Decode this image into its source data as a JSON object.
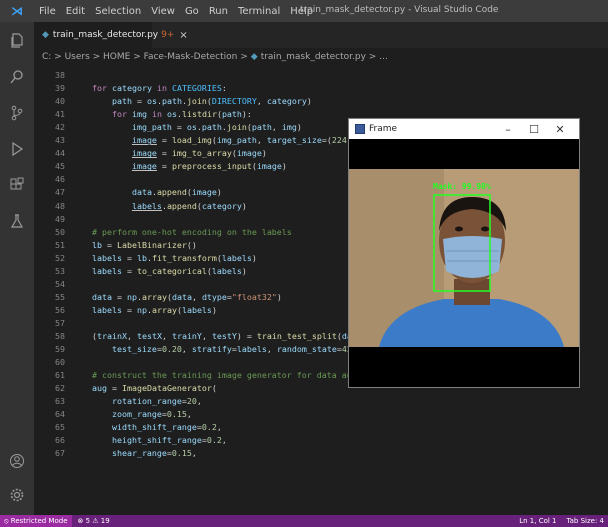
{
  "titlebar": {
    "menu": [
      "File",
      "Edit",
      "Selection",
      "View",
      "Go",
      "Run",
      "Terminal",
      "Help"
    ],
    "window_title": "train_mask_detector.py - Visual Studio Code"
  },
  "tab": {
    "label": "train_mask_detector.py",
    "problems_badge": "9+",
    "close": "×"
  },
  "breadcrumb": {
    "path": "C: > Users > HOME > Face-Mask-Detection >",
    "file": "train_mask_detector.py >",
    "tail": "..."
  },
  "frame_window": {
    "title": "Frame",
    "minimize": "–",
    "maximize": "☐",
    "close": "✕",
    "detection_label": "Mask: 99.98%"
  },
  "code_lines": [
    {
      "n": "38",
      "t": []
    },
    {
      "n": "39",
      "t": [
        [
          "    ",
          ""
        ],
        [
          "for",
          "kw"
        ],
        [
          " ",
          ""
        ],
        [
          "category",
          "var"
        ],
        [
          " ",
          ""
        ],
        [
          "in",
          "kw"
        ],
        [
          " ",
          ""
        ],
        [
          "CATEGORIES",
          "cst"
        ],
        [
          ":",
          ""
        ]
      ]
    },
    {
      "n": "40",
      "t": [
        [
          "        ",
          ""
        ],
        [
          "path",
          "var"
        ],
        [
          " = ",
          ""
        ],
        [
          "os",
          "var"
        ],
        [
          ".",
          ""
        ],
        [
          "path",
          "var"
        ],
        [
          ".",
          ""
        ],
        [
          "join",
          "fn"
        ],
        [
          "(",
          ""
        ],
        [
          "DIRECTORY",
          "cst"
        ],
        [
          ", ",
          ""
        ],
        [
          "category",
          "var"
        ],
        [
          ")",
          ""
        ]
      ]
    },
    {
      "n": "41",
      "t": [
        [
          "        ",
          ""
        ],
        [
          "for",
          "kw"
        ],
        [
          " ",
          ""
        ],
        [
          "img",
          "var"
        ],
        [
          " ",
          ""
        ],
        [
          "in",
          "kw"
        ],
        [
          " ",
          ""
        ],
        [
          "os",
          "var"
        ],
        [
          ".",
          ""
        ],
        [
          "listdir",
          "fn"
        ],
        [
          "(",
          ""
        ],
        [
          "path",
          "var"
        ],
        [
          "):",
          ""
        ]
      ]
    },
    {
      "n": "42",
      "t": [
        [
          "            ",
          ""
        ],
        [
          "img_path",
          "var"
        ],
        [
          " = ",
          ""
        ],
        [
          "os",
          "var"
        ],
        [
          ".",
          ""
        ],
        [
          "path",
          "var"
        ],
        [
          ".",
          ""
        ],
        [
          "join",
          "fn"
        ],
        [
          "(",
          ""
        ],
        [
          "path",
          "var"
        ],
        [
          ", ",
          ""
        ],
        [
          "img",
          "var"
        ],
        [
          ")",
          ""
        ]
      ]
    },
    {
      "n": "43",
      "t": [
        [
          "            ",
          ""
        ],
        [
          "image",
          "var und"
        ],
        [
          " = ",
          ""
        ],
        [
          "load_img",
          "fn"
        ],
        [
          "(",
          ""
        ],
        [
          "img_path",
          "var"
        ],
        [
          ", ",
          ""
        ],
        [
          "target_size",
          "var"
        ],
        [
          "=(",
          ""
        ],
        [
          "224",
          "num"
        ],
        [
          ", ",
          ""
        ],
        [
          "224",
          "num"
        ],
        [
          "))",
          ""
        ]
      ]
    },
    {
      "n": "44",
      "t": [
        [
          "            ",
          ""
        ],
        [
          "image",
          "var und"
        ],
        [
          " = ",
          ""
        ],
        [
          "img_to_array",
          "fn"
        ],
        [
          "(",
          ""
        ],
        [
          "image",
          "var"
        ],
        [
          ")",
          ""
        ]
      ]
    },
    {
      "n": "45",
      "t": [
        [
          "            ",
          ""
        ],
        [
          "image",
          "var und"
        ],
        [
          " = ",
          ""
        ],
        [
          "preprocess_input",
          "fn"
        ],
        [
          "(",
          ""
        ],
        [
          "image",
          "var"
        ],
        [
          ")",
          ""
        ]
      ]
    },
    {
      "n": "46",
      "t": []
    },
    {
      "n": "47",
      "t": [
        [
          "            ",
          ""
        ],
        [
          "data",
          "var"
        ],
        [
          ".",
          ""
        ],
        [
          "append",
          "fn"
        ],
        [
          "(",
          ""
        ],
        [
          "image",
          "var"
        ],
        [
          ")",
          ""
        ]
      ]
    },
    {
      "n": "48",
      "t": [
        [
          "            ",
          ""
        ],
        [
          "labels",
          "var und"
        ],
        [
          ".",
          ""
        ],
        [
          "append",
          "fn"
        ],
        [
          "(",
          ""
        ],
        [
          "category",
          "var"
        ],
        [
          ")",
          ""
        ]
      ]
    },
    {
      "n": "49",
      "t": []
    },
    {
      "n": "50",
      "t": [
        [
          "    ",
          ""
        ],
        [
          "# perform one-hot encoding on the labels",
          "cmt"
        ]
      ]
    },
    {
      "n": "51",
      "t": [
        [
          "    ",
          ""
        ],
        [
          "lb",
          "var"
        ],
        [
          " = ",
          ""
        ],
        [
          "LabelBinarizer",
          "fn"
        ],
        [
          "()",
          ""
        ]
      ]
    },
    {
      "n": "52",
      "t": [
        [
          "    ",
          ""
        ],
        [
          "labels",
          "var"
        ],
        [
          " = ",
          ""
        ],
        [
          "lb",
          "var"
        ],
        [
          ".",
          ""
        ],
        [
          "fit_transform",
          "fn"
        ],
        [
          "(",
          ""
        ],
        [
          "labels",
          "var"
        ],
        [
          ")",
          ""
        ]
      ]
    },
    {
      "n": "53",
      "t": [
        [
          "    ",
          ""
        ],
        [
          "labels",
          "var"
        ],
        [
          " = ",
          ""
        ],
        [
          "to_categorical",
          "fn"
        ],
        [
          "(",
          ""
        ],
        [
          "labels",
          "var"
        ],
        [
          ")",
          ""
        ]
      ]
    },
    {
      "n": "54",
      "t": []
    },
    {
      "n": "55",
      "t": [
        [
          "    ",
          ""
        ],
        [
          "data",
          "var"
        ],
        [
          " = ",
          ""
        ],
        [
          "np",
          "var"
        ],
        [
          ".",
          ""
        ],
        [
          "array",
          "fn"
        ],
        [
          "(",
          ""
        ],
        [
          "data",
          "var"
        ],
        [
          ", ",
          ""
        ],
        [
          "dtype",
          "var"
        ],
        [
          "=",
          ""
        ],
        [
          "\"float32\"",
          "str"
        ],
        [
          ")",
          ""
        ]
      ]
    },
    {
      "n": "56",
      "t": [
        [
          "    ",
          ""
        ],
        [
          "labels",
          "var"
        ],
        [
          " = ",
          ""
        ],
        [
          "np",
          "var"
        ],
        [
          ".",
          ""
        ],
        [
          "array",
          "fn"
        ],
        [
          "(",
          ""
        ],
        [
          "labels",
          "var"
        ],
        [
          ")",
          ""
        ]
      ]
    },
    {
      "n": "57",
      "t": []
    },
    {
      "n": "58",
      "t": [
        [
          "    ",
          ""
        ],
        [
          "(",
          ""
        ],
        [
          "trainX",
          "var"
        ],
        [
          ", ",
          ""
        ],
        [
          "testX",
          "var"
        ],
        [
          ", ",
          ""
        ],
        [
          "trainY",
          "var"
        ],
        [
          ", ",
          ""
        ],
        [
          "testY",
          "var"
        ],
        [
          ") = ",
          ""
        ],
        [
          "train_test_split",
          "fn"
        ],
        [
          "(",
          ""
        ],
        [
          "data",
          "var"
        ],
        [
          ", ",
          ""
        ],
        [
          "labels",
          "var"
        ],
        [
          ",",
          ""
        ]
      ]
    },
    {
      "n": "59",
      "t": [
        [
          "        ",
          ""
        ],
        [
          "test_size",
          "var"
        ],
        [
          "=",
          ""
        ],
        [
          "0.20",
          "num"
        ],
        [
          ", ",
          ""
        ],
        [
          "stratify",
          "var"
        ],
        [
          "=",
          ""
        ],
        [
          "labels",
          "var"
        ],
        [
          ", ",
          ""
        ],
        [
          "random_state",
          "var"
        ],
        [
          "=",
          ""
        ],
        [
          "42",
          "num"
        ],
        [
          ")",
          ""
        ]
      ]
    },
    {
      "n": "60",
      "t": []
    },
    {
      "n": "61",
      "t": [
        [
          "    ",
          ""
        ],
        [
          "# construct the training image generator for data augmentation",
          "cmt"
        ]
      ]
    },
    {
      "n": "62",
      "t": [
        [
          "    ",
          ""
        ],
        [
          "aug",
          "var"
        ],
        [
          " = ",
          ""
        ],
        [
          "ImageDataGenerator",
          "fn"
        ],
        [
          "(",
          ""
        ]
      ]
    },
    {
      "n": "63",
      "t": [
        [
          "        ",
          ""
        ],
        [
          "rotation_range",
          "var"
        ],
        [
          "=",
          ""
        ],
        [
          "20",
          "num"
        ],
        [
          ",",
          ""
        ]
      ]
    },
    {
      "n": "64",
      "t": [
        [
          "        ",
          ""
        ],
        [
          "zoom_range",
          "var"
        ],
        [
          "=",
          ""
        ],
        [
          "0.15",
          "num"
        ],
        [
          ",",
          ""
        ]
      ]
    },
    {
      "n": "65",
      "t": [
        [
          "        ",
          ""
        ],
        [
          "width_shift_range",
          "var"
        ],
        [
          "=",
          ""
        ],
        [
          "0.2",
          "num"
        ],
        [
          ",",
          ""
        ]
      ]
    },
    {
      "n": "66",
      "t": [
        [
          "        ",
          ""
        ],
        [
          "height_shift_range",
          "var"
        ],
        [
          "=",
          ""
        ],
        [
          "0.2",
          "num"
        ],
        [
          ",",
          ""
        ]
      ]
    },
    {
      "n": "67",
      "t": [
        [
          "        ",
          ""
        ],
        [
          "shear_range",
          "var"
        ],
        [
          "=",
          ""
        ],
        [
          "0.15",
          "num"
        ],
        [
          ",",
          ""
        ]
      ]
    }
  ],
  "status": {
    "restricted": "⦸ Restricted Mode",
    "problems": "⊗ 5 ⚠ 19",
    "position": "Ln 1, Col 1",
    "tab_size": "Tab Size: 4"
  },
  "colors": {
    "editor_bg": "#1e1e1e",
    "status_bar": "#68217a",
    "detection_box": "#22ff22"
  }
}
